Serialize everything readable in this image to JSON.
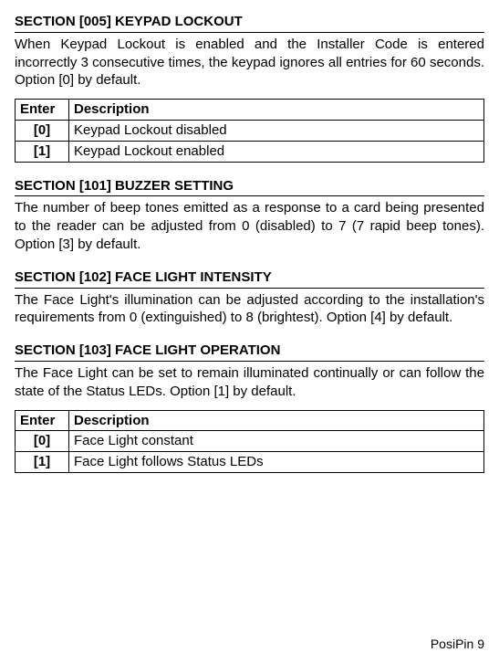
{
  "sections": [
    {
      "heading": "SECTION [005] KEYPAD LOCKOUT",
      "body": "When Keypad Lockout is enabled and the Installer Code is entered incorrectly 3 consecutive times, the keypad ignores all entries for 60 seconds. Option [0] by default.",
      "table": {
        "headers": [
          "Enter",
          "Description"
        ],
        "rows": [
          [
            "[0]",
            "Keypad Lockout disabled"
          ],
          [
            "[1]",
            "Keypad Lockout enabled"
          ]
        ]
      }
    },
    {
      "heading": "SECTION [101] BUZZER SETTING",
      "body": "The number of beep tones emitted as a response to a card being presented to the reader can be adjusted from 0 (disabled) to 7 (7 rapid beep tones). Option [3] by default."
    },
    {
      "heading": "SECTION [102] FACE LIGHT INTENSITY",
      "body": "The Face Light's illumination can be adjusted according to the installation's requirements from 0 (extinguished) to 8 (brightest). Option [4] by default."
    },
    {
      "heading": "SECTION [103] FACE LIGHT OPERATION",
      "body": "The Face Light can be set to remain illuminated continually or can follow the state of the Status LEDs. Option [1] by default.",
      "table": {
        "headers": [
          "Enter",
          "Description"
        ],
        "rows": [
          [
            "[0]",
            "Face Light constant"
          ],
          [
            "[1]",
            "Face Light follows Status LEDs"
          ]
        ]
      }
    }
  ],
  "footer": "PosiPin 9"
}
